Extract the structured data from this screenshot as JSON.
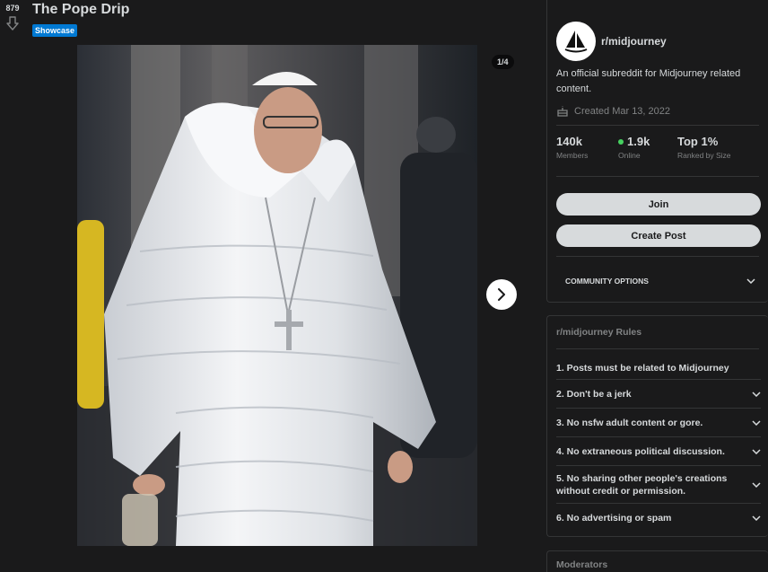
{
  "post": {
    "vote_count": "879",
    "title": "The Pope Drip",
    "flair": "Showcase",
    "gallery_counter": "1/4"
  },
  "sidebar": {
    "subreddit_name": "r/midjourney",
    "description": "An official subreddit for Midjourney related content.",
    "created": "Created Mar 13, 2022",
    "stats": [
      {
        "value": "140k",
        "label": "Members"
      },
      {
        "value": "1.9k",
        "label": "Online"
      },
      {
        "value": "Top 1%",
        "label": "Ranked by Size"
      }
    ],
    "join_label": "Join",
    "create_post_label": "Create Post",
    "community_options_label": "COMMUNITY OPTIONS",
    "rules_title": "r/midjourney Rules",
    "rules": [
      {
        "text": "1. Posts must be related to Midjourney"
      },
      {
        "text": "2. Don't be a jerk"
      },
      {
        "text": "3. No nsfw adult content or gore."
      },
      {
        "text": "4. No extraneous political discussion."
      },
      {
        "text": "5. No sharing other people's creations without credit or permission."
      },
      {
        "text": "6. No advertising or spam"
      }
    ],
    "moderators_title": "Moderators"
  },
  "colors": {
    "background": "#1a1a1b",
    "flair": "#0079d3",
    "online": "#46d160",
    "button": "#d7dadc"
  },
  "icons": [
    "downvote-icon",
    "chevron-right-icon",
    "cake-icon",
    "chevron-down-icon",
    "sailboat-logo"
  ]
}
